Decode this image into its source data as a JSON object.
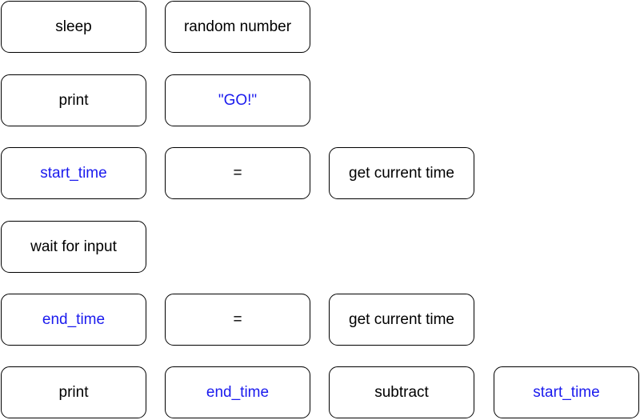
{
  "colors": {
    "keyword": "#000000",
    "variable": "#1a1aee",
    "border": "#000000",
    "background": "#ffffff"
  },
  "rows": [
    {
      "blocks": [
        {
          "text": "sleep",
          "kind": "keyword"
        },
        {
          "text": "random number",
          "kind": "keyword"
        }
      ]
    },
    {
      "blocks": [
        {
          "text": "print",
          "kind": "keyword"
        },
        {
          "text": "\"GO!\"",
          "kind": "variable"
        }
      ]
    },
    {
      "blocks": [
        {
          "text": "start_time",
          "kind": "variable"
        },
        {
          "text": "=",
          "kind": "keyword"
        },
        {
          "text": "get current time",
          "kind": "keyword"
        }
      ]
    },
    {
      "blocks": [
        {
          "text": "wait for input",
          "kind": "keyword"
        }
      ]
    },
    {
      "blocks": [
        {
          "text": "end_time",
          "kind": "variable"
        },
        {
          "text": "=",
          "kind": "keyword"
        },
        {
          "text": "get current time",
          "kind": "keyword"
        }
      ]
    },
    {
      "blocks": [
        {
          "text": "print",
          "kind": "keyword"
        },
        {
          "text": "end_time",
          "kind": "variable"
        },
        {
          "text": "subtract",
          "kind": "keyword"
        },
        {
          "text": "start_time",
          "kind": "variable"
        }
      ]
    }
  ]
}
